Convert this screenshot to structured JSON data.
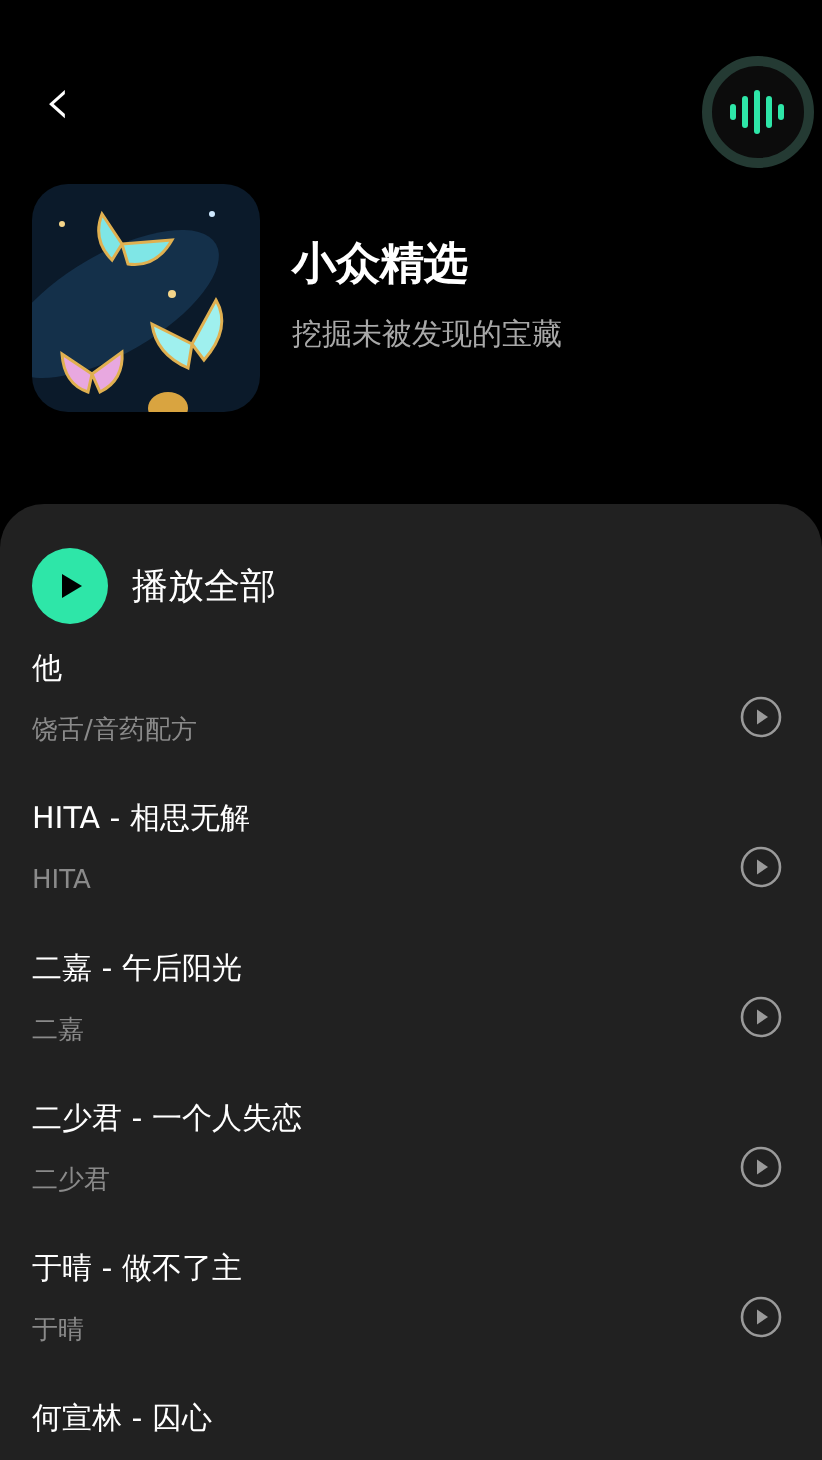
{
  "header": {
    "back": "‹"
  },
  "playlist": {
    "title": "小众精选",
    "subtitle": "挖掘未被发现的宝藏"
  },
  "play_all": {
    "label": "播放全部"
  },
  "songs": [
    {
      "title": "他",
      "artist": "饶舌/音药配方",
      "play_icon": true
    },
    {
      "title": "HITA - 相思无解",
      "artist": "HITA",
      "play_icon": true
    },
    {
      "title": "二嘉 - 午后阳光",
      "artist": "二嘉",
      "play_icon": true
    },
    {
      "title": "二少君 - 一个人失恋",
      "artist": "二少君",
      "play_icon": true
    },
    {
      "title": "于晴 - 做不了主",
      "artist": "于晴",
      "play_icon": true
    },
    {
      "title": "何宣林 - 囚心",
      "play_icon": false
    }
  ]
}
